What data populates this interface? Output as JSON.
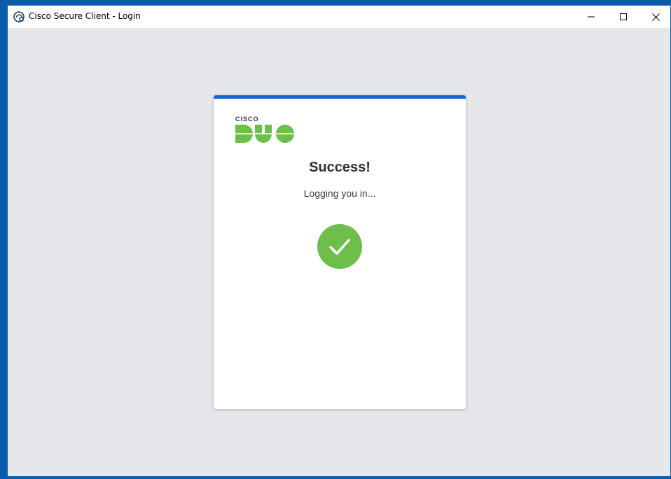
{
  "window": {
    "title": "Cisco Secure Client - Login",
    "controls": {
      "minimize": "minimize",
      "maximize": "maximize",
      "close": "close"
    }
  },
  "card": {
    "logo": {
      "brand_small": "CISCO",
      "brand_large": "DUO",
      "color": "#6dbe4b"
    },
    "heading": "Success!",
    "message": "Logging you in...",
    "status_icon": "check-icon",
    "accent_color": "#1467d8",
    "success_color": "#6dbe4b"
  }
}
